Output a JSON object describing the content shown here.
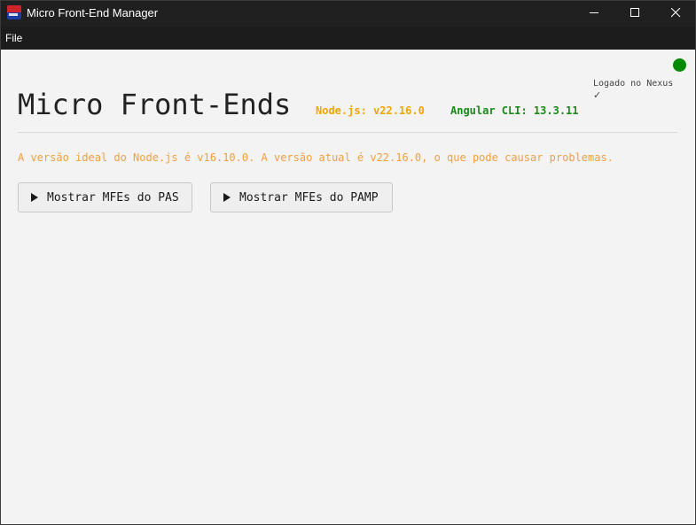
{
  "window": {
    "title": "Micro Front-End Manager",
    "icon": "app-logo-icon",
    "controls": {
      "minimize": "minimize-icon",
      "maximize": "maximize-icon",
      "close": "close-icon"
    }
  },
  "menubar": {
    "items": [
      {
        "label": "File"
      }
    ]
  },
  "header": {
    "title": "Micro Front-Ends",
    "node_version": "Node.js: v22.16.0",
    "angular_version": "Angular CLI: 13.3.11",
    "nexus_status": "Logado no Nexus",
    "nexus_check": "✓",
    "status_color": "#008a00"
  },
  "warning": {
    "text": "A versão ideal do Node.js é v16.10.0. A versão atual é v22.16.0, o que pode causar problemas.",
    "color": "#f0a040"
  },
  "actions": {
    "show_pas": "Mostrar MFEs do PAS",
    "show_pamp": "Mostrar MFEs do PAMP"
  },
  "colors": {
    "node_version": "#f0a500",
    "angular_version": "#1a8a1a",
    "titlebar": "#202020",
    "menubar": "#1c1c1c",
    "background": "#f3f3f3"
  }
}
